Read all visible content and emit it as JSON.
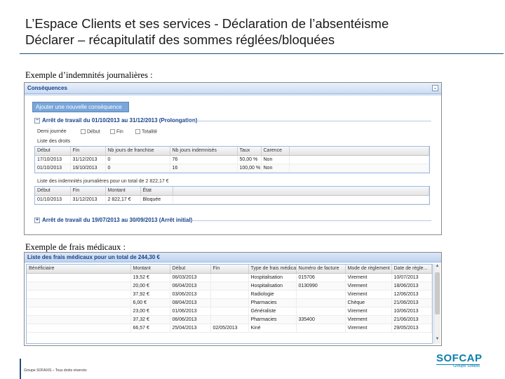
{
  "slide": {
    "title_line1": "L’Espace Clients et ses services - Déclaration de l’absentéisme",
    "title_line2": "Déclarer – récapitulatif des sommes réglées/bloquées",
    "caption1": "Exemple d’indemnités journalières :",
    "caption2": "Exemple de frais médicaux :"
  },
  "shot1": {
    "panel_title": "Conséquences",
    "toggle": "-",
    "add_button": "Ajouter une nouvelle conséquence",
    "arret1_label": "Arrêt de travail du 01/10/2013 au 31/12/2013 (Prolongation)",
    "demi_journee": "Demi journée",
    "chk1": "Début",
    "chk2": "Fin",
    "chk3": "Totalité",
    "liste_droits": "Liste des droits",
    "droits_headers": [
      "Début",
      "Fin",
      "Nb jours de franchise",
      "Nb jours indemnisés",
      "Taux",
      "Carence"
    ],
    "droits_rows": [
      [
        "17/10/2013",
        "31/12/2013",
        "0",
        "76",
        "50,00 %",
        "Non"
      ],
      [
        "01/10/2013",
        "16/10/2013",
        "0",
        "16",
        "100,00 %",
        "Non"
      ]
    ],
    "indemnites_label": "Liste des indemnités journalières pour un total de 2 822,17 €",
    "ind_headers": [
      "Début",
      "Fin",
      "Montant",
      "État"
    ],
    "ind_rows": [
      [
        "01/10/2013",
        "31/12/2013",
        "2 822,17 €",
        "Bloquée"
      ]
    ],
    "arret2_label": "Arrêt de travail du 19/07/2013 au 30/09/2013 (Arrêt initial)"
  },
  "shot2": {
    "panel_title": "Liste des frais médicaux pour un total de 244,30 €",
    "headers": [
      "Bénéficiaire",
      "Montant",
      "Début",
      "Fin",
      "Type de frais médical",
      "Numéro de facture",
      "Mode de règlement",
      "Date de règle..."
    ],
    "rows": [
      [
        "",
        "19,52 €",
        "06/03/2013",
        "",
        "Hospitalisation",
        "015706",
        "Virement",
        "10/07/2013"
      ],
      [
        "",
        "20,00 €",
        "06/04/2013",
        "",
        "Hospitalisation",
        "0130990",
        "Virement",
        "18/06/2013"
      ],
      [
        "",
        "37,92 €",
        "03/06/2013",
        "",
        "Radiologie",
        "",
        "Virement",
        "12/06/2013"
      ],
      [
        "",
        "6,00 €",
        "08/04/2013",
        "",
        "Pharmacies",
        "",
        "Chèque",
        "21/06/2013"
      ],
      [
        "",
        "23,00 €",
        "01/06/2013",
        "",
        "Généraliste",
        "",
        "Virement",
        "10/06/2013"
      ],
      [
        "",
        "37,32 €",
        "06/06/2013",
        "",
        "Pharmacies",
        "335400",
        "Virement",
        "21/06/2013"
      ],
      [
        "",
        "66,57 €",
        "25/04/2013",
        "02/05/2013",
        "Kiné",
        "",
        "Virement",
        "29/05/2013"
      ]
    ]
  },
  "footer": {
    "text": "Groupe SOFAXIS – Tous droits réservés",
    "logo_main": "SOFCAP",
    "logo_sub": "Groupe Sofaxis"
  }
}
